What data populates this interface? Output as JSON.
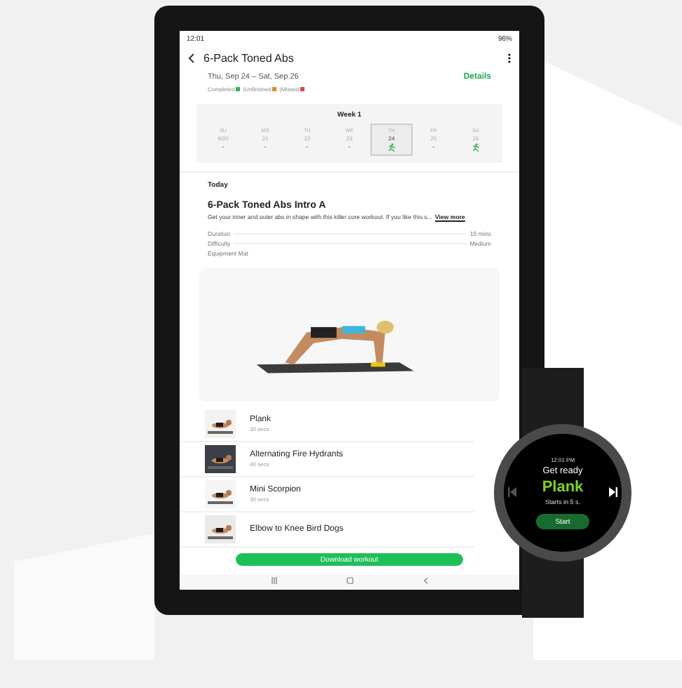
{
  "status_bar": {
    "time": "12:01",
    "battery": "96%"
  },
  "header": {
    "title": "6-Pack Toned Abs"
  },
  "schedule": {
    "range": "Thu, Sep 24 – Sat, Sep 26",
    "details_link": "Details",
    "separator": "|",
    "legend": [
      {
        "label": "Completed",
        "color": "#2fb15a"
      },
      {
        "label": "Unfinished",
        "color": "#e08a2c"
      },
      {
        "label": "Missed",
        "color": "#d9473f"
      }
    ]
  },
  "week": {
    "title": "Week 1",
    "days": [
      {
        "weekday": "SU",
        "date": "9/20",
        "mark": "-",
        "done": false,
        "selected": false
      },
      {
        "weekday": "MO",
        "date": "21",
        "mark": "-",
        "done": false,
        "selected": false
      },
      {
        "weekday": "TU",
        "date": "22",
        "mark": "-",
        "done": false,
        "selected": false
      },
      {
        "weekday": "WE",
        "date": "23",
        "mark": "-",
        "done": false,
        "selected": false
      },
      {
        "weekday": "TH",
        "date": "24",
        "done": true,
        "selected": true
      },
      {
        "weekday": "FR",
        "date": "25",
        "mark": "-",
        "done": false,
        "selected": false
      },
      {
        "weekday": "SA",
        "date": "26",
        "done": true,
        "selected": false
      }
    ]
  },
  "today": {
    "heading": "Today",
    "title": "6-Pack Toned Abs Intro A",
    "description": "Get your inner and outer abs in shape with this killer core workout. If you like this s...",
    "view_more": "View more",
    "facts": [
      {
        "label": "Duration",
        "value": "15 mins"
      },
      {
        "label": "Difficulty",
        "value": "Medium"
      },
      {
        "label": "Equipment Mat"
      }
    ]
  },
  "exercises": [
    {
      "name": "Plank",
      "duration": "30 secs"
    },
    {
      "name": "Alternating Fire Hydrants",
      "duration": "40 secs"
    },
    {
      "name": "Mini Scorpion",
      "duration": "30 secs"
    },
    {
      "name": "Elbow to Knee Bird Dogs"
    }
  ],
  "download_button": "Download workout",
  "watch": {
    "time": "12:01 PM",
    "prompt": "Get ready",
    "exercise": "Plank",
    "countdown": "Starts in 5 s.",
    "start_button": "Start"
  }
}
